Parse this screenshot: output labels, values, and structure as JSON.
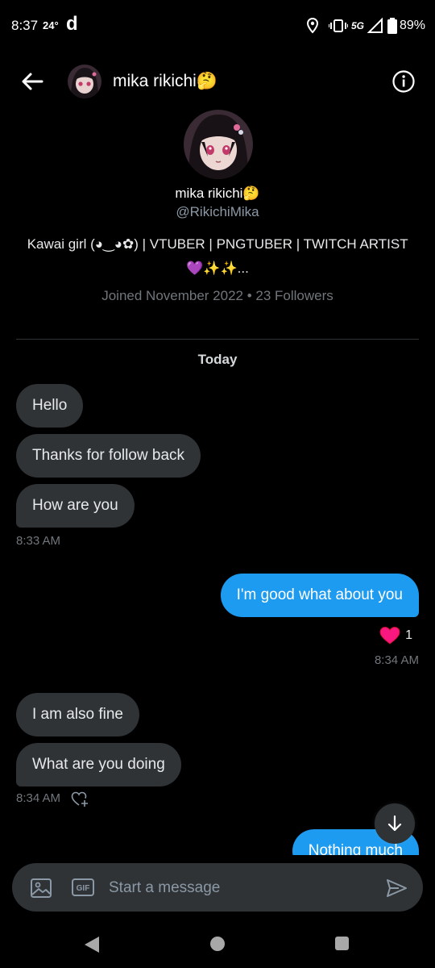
{
  "status_bar": {
    "time": "8:37",
    "temperature": "24°",
    "app_icon_letter": "d",
    "network": "5G",
    "battery": "89%"
  },
  "header": {
    "name": "mika rikichi🤔"
  },
  "profile": {
    "name": "mika rikichi🤔",
    "handle": "@RikichiMika",
    "bio_text": "Kawai girl (◕‿◕✿) | VTUBER | PNGTUBER | TWITCH ARTIST",
    "bio_heart": "💜",
    "bio_sparkles": "✨✨",
    "bio_ellipsis": "...",
    "meta": "Joined November 2022 • 23 Followers"
  },
  "conversation": {
    "day_label": "Today",
    "messages": [
      {
        "text": "Hello",
        "direction": "incoming"
      },
      {
        "text": "Thanks for follow back",
        "direction": "incoming"
      },
      {
        "text": "How are you",
        "direction": "incoming"
      },
      {
        "text": "I'm good what about you",
        "direction": "outgoing"
      },
      {
        "text": "I am also fine",
        "direction": "incoming"
      },
      {
        "text": "What are you doing",
        "direction": "incoming"
      },
      {
        "text": "Nothing much",
        "direction": "outgoing"
      }
    ],
    "timestamps": [
      "8:33 AM",
      "8:34 AM",
      "8:34 AM"
    ],
    "reaction": {
      "emoji": "heart",
      "count": "1"
    }
  },
  "composer": {
    "placeholder": "Start a message",
    "gif_label": "GIF"
  },
  "colors": {
    "background": "#000000",
    "incoming_bubble": "#2f3336",
    "outgoing_bubble": "#1d9bf0",
    "muted_text": "#71767b",
    "reaction_heart": "#f91880"
  }
}
